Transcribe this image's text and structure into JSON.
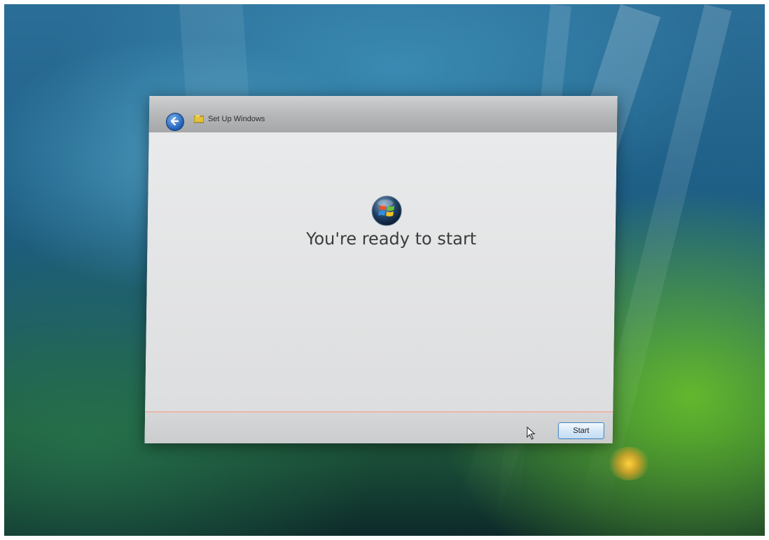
{
  "window": {
    "title": "Set Up Windows",
    "heading": "You're ready to start",
    "start_label": "Start"
  },
  "icons": {
    "back": "back-arrow-icon",
    "app": "setup-icon",
    "logo": "windows-orb-icon",
    "pointer": "mouse-pointer-icon"
  },
  "colors": {
    "accent": "#3b82c4",
    "divider": "#e7b7a8"
  }
}
